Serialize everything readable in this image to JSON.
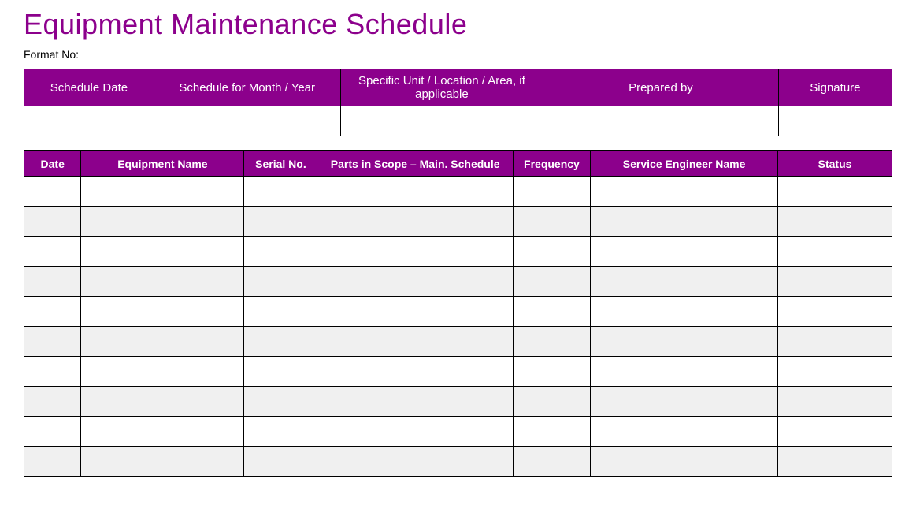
{
  "title": "Equipment Maintenance Schedule",
  "format_label": "Format No:",
  "info_headers": {
    "schedule_date": "Schedule Date",
    "schedule_for": "Schedule for Month / Year",
    "unit_location": "Specific Unit / Location  / Area, if applicable",
    "prepared_by": "Prepared  by",
    "signature": "Signature"
  },
  "info_row": {
    "schedule_date": "",
    "schedule_for": "",
    "unit_location": "",
    "prepared_by": "",
    "signature": ""
  },
  "main_headers": {
    "date": "Date",
    "equipment_name": "Equipment Name",
    "serial_no": "Serial No.",
    "parts_scope": "Parts in Scope – Main. Schedule",
    "frequency": "Frequency",
    "engineer": "Service Engineer Name",
    "status": "Status"
  },
  "rows": [
    {
      "date": "",
      "equipment_name": "",
      "serial_no": "",
      "parts_scope": "",
      "frequency": "",
      "engineer": "",
      "status": ""
    },
    {
      "date": "",
      "equipment_name": "",
      "serial_no": "",
      "parts_scope": "",
      "frequency": "",
      "engineer": "",
      "status": ""
    },
    {
      "date": "",
      "equipment_name": "",
      "serial_no": "",
      "parts_scope": "",
      "frequency": "",
      "engineer": "",
      "status": ""
    },
    {
      "date": "",
      "equipment_name": "",
      "serial_no": "",
      "parts_scope": "",
      "frequency": "",
      "engineer": "",
      "status": ""
    },
    {
      "date": "",
      "equipment_name": "",
      "serial_no": "",
      "parts_scope": "",
      "frequency": "",
      "engineer": "",
      "status": ""
    },
    {
      "date": "",
      "equipment_name": "",
      "serial_no": "",
      "parts_scope": "",
      "frequency": "",
      "engineer": "",
      "status": ""
    },
    {
      "date": "",
      "equipment_name": "",
      "serial_no": "",
      "parts_scope": "",
      "frequency": "",
      "engineer": "",
      "status": ""
    },
    {
      "date": "",
      "equipment_name": "",
      "serial_no": "",
      "parts_scope": "",
      "frequency": "",
      "engineer": "",
      "status": ""
    },
    {
      "date": "",
      "equipment_name": "",
      "serial_no": "",
      "parts_scope": "",
      "frequency": "",
      "engineer": "",
      "status": ""
    },
    {
      "date": "",
      "equipment_name": "",
      "serial_no": "",
      "parts_scope": "",
      "frequency": "",
      "engineer": "",
      "status": ""
    }
  ]
}
